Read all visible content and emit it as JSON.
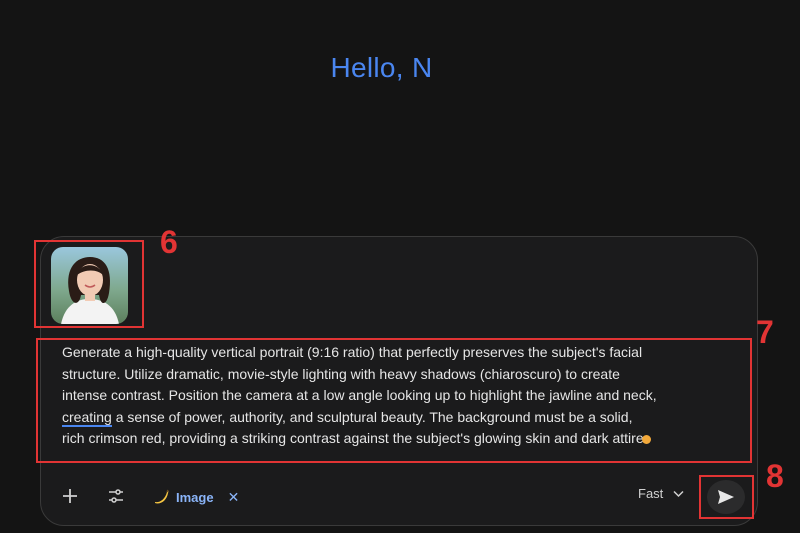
{
  "greeting": "Hello, N",
  "attachment": {
    "alt": "portrait-photo-thumbnail"
  },
  "prompt": {
    "line1": "Generate a high-quality vertical portrait (9:16 ratio) that perfectly preserves the subject's facial",
    "line2": "structure. Utilize dramatic, movie-style lighting with heavy shadows (chiaroscuro) to create",
    "line3": "intense contrast. Position the camera at a low angle looking up to highlight the jawline and neck,",
    "line4_word": "creating",
    "line4_rest": " a sense of power, authority, and sculptural beauty. The background must be a solid,",
    "line5": "rich crimson red, providing a striking contrast against the subject's glowing skin and dark attire."
  },
  "toolbar": {
    "add_icon": "plus-icon",
    "tools_icon": "sliders-icon",
    "chip_icon": "banana-icon",
    "chip_label": "Image",
    "chip_close": "✕",
    "mode_label": "Fast",
    "mode_icon": "chevron-down-icon",
    "send_icon": "send-icon"
  },
  "callouts": {
    "thumb": "6",
    "prompt": "7",
    "send": "8"
  },
  "colors": {
    "accent": "#4a86f0",
    "annotation": "#e23434",
    "chip": "#8ab4f8"
  }
}
